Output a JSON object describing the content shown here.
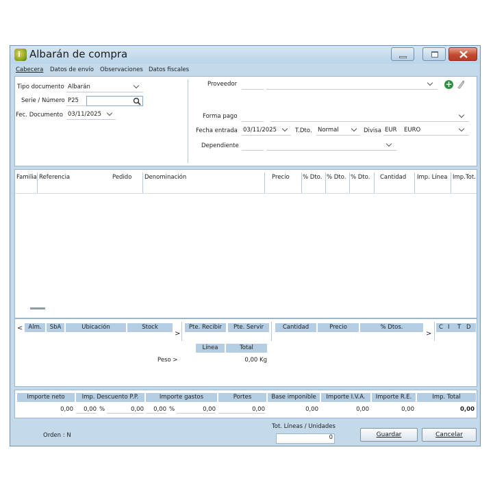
{
  "window": {
    "title": "Albarán de compra"
  },
  "tabs": [
    "Cabecera",
    "Datos de envío",
    "Observaciones",
    "Datos fiscales"
  ],
  "header": {
    "tipo_documento_label": "Tipo documento",
    "tipo_documento_value": "Albarán",
    "serie_label": "Serie / Número",
    "serie_value": "P25",
    "numero_value": "",
    "fecha_label": "Fec. Documento",
    "fecha_value": "03/11/2025",
    "proveedor_label": "Proveedor",
    "proveedor_code": "",
    "proveedor_name": "",
    "forma_pago_label": "Forma pago",
    "forma_pago_code": "",
    "forma_pago_name": "",
    "fecha_entrada_label": "Fecha entrada",
    "fecha_entrada_value": "03/11/2025",
    "tdto_label": "T.Dto.",
    "tdto_value": "Normal",
    "divisa_label": "Divisa",
    "divisa_code": "EUR",
    "divisa_name": "EURO",
    "dependiente_label": "Dependiente",
    "dependiente_code": "",
    "dependiente_name": ""
  },
  "lines_grid": {
    "columns": [
      "Familia",
      "Referencia",
      "Pedido",
      "Denominación",
      "Precio",
      "% Dto.",
      "% Dto.",
      "% Dto.",
      "Cantidad",
      "Imp. Línea",
      "Imp.Tot."
    ],
    "rows": []
  },
  "stock_grid": {
    "left_arrow": "<",
    "right_arrow": ">",
    "columns_left": [
      "Alm.",
      "SbA",
      "Ubicación",
      "Stock"
    ],
    "columns_mid": [
      "Pte. Recibir",
      "Pte. Servir"
    ],
    "columns_right": [
      "Cantidad",
      "Precio",
      "% Dtos."
    ],
    "flags": [
      "C",
      "I",
      "T",
      "D"
    ],
    "linea_label": "Línea",
    "total_label": "Total",
    "peso_label": "Peso >",
    "peso_value": "0,00 Kg"
  },
  "totals": {
    "headers": [
      "Importe neto",
      "Imp. Descuento P.P.",
      "Importe gastos",
      "Portes",
      "Base imponible",
      "Importe I.V.A.",
      "Importe R.E.",
      "Imp. Total"
    ],
    "importe_neto": "0,00",
    "dto_pp_pct": "0,00",
    "dto_pp_sign": "%",
    "dto_pp_value": "0,00",
    "gastos_pct": "0,00",
    "gastos_sign": "%",
    "gastos_value": "0,00",
    "portes": "0,00",
    "base_imponible": "0,00",
    "iva": "0,00",
    "re": "0,00",
    "total": "0,00"
  },
  "footer": {
    "orden_label": "Orden : N",
    "tot_lineas_label": "Tot. Líneas / Unidades",
    "tot_lineas_value": "0",
    "guardar_label": "Guardar",
    "cancelar_label": "Cancelar"
  }
}
